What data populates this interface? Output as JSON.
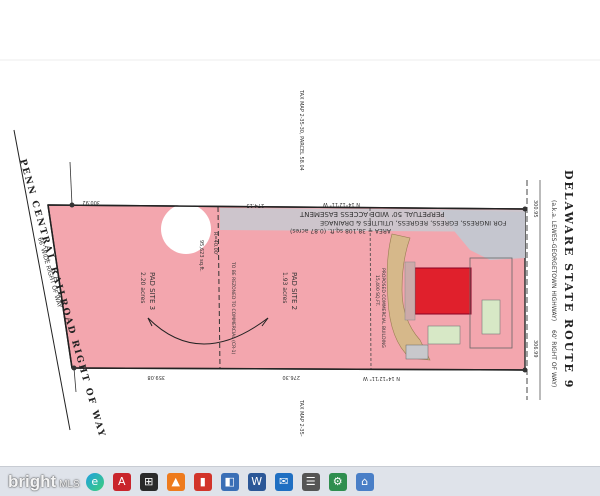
{
  "map": {
    "road_name": "DELAWARE STATE ROUTE 9",
    "road_aka": "(a.k.a. LEWES-GEORGETOWN HIGHWAY)",
    "road_row": "60' RIGHT OF WAY)",
    "railroad_name": "PENN CENTRAL RAILROAD RIGHT OF WAY",
    "railroad_row": "66' WIDE RIGHT OF WAY",
    "easement_line1": "PERPETUAL 50' WIDE ACCESS EASEMENT",
    "easement_line2": "FOR INGRESS, EGRESS, REGRESS, UTILITIES & DRAINAGE",
    "easement_area": "AREA = 38,108 sq.ft. (0.87 acres)",
    "pad_site_2": "PAD SITE 2",
    "pad_site_2_area": "1.93 acres",
    "pad_site_3": "PAD SITE 3",
    "pad_site_3_area": "2.20 acres",
    "pad_site_3_sqft": "95,623 sq.ft.",
    "tax_map_top": "TAX MAP 2-35-30, PARCEL 58.04",
    "tax_map_bottom": "TAX MAP 2-35-",
    "dim_top_left": "300.92",
    "dim_top_mid": "274.15",
    "dim_bottom_left": "359.08",
    "dim_bottom_mid": "276.30",
    "dim_right_top": "300.95",
    "dim_right_bottom": "306.99",
    "bearing_top": "N 14°12'11\" W",
    "bearing_bottom": "N 14°12'11\" W",
    "radius_label": "R=40.00'",
    "pad1_label": "PROPOSED COMMERCIAL BUILDING",
    "pad1_sub": "15,400 SQ.FT.",
    "to_be_rezoned": "TO BE REZONED TO COMMERCIAL (CR-1)"
  },
  "taskbar": {
    "brand": "bright",
    "brand_suffix": "MLS",
    "icons": [
      "windows-icon",
      "edge-icon",
      "acrobat-icon",
      "store-icon",
      "cart-icon",
      "chart-icon",
      "photos-icon",
      "word-icon",
      "mail-icon",
      "explorer-icon",
      "settings-icon",
      "home-icon"
    ]
  }
}
